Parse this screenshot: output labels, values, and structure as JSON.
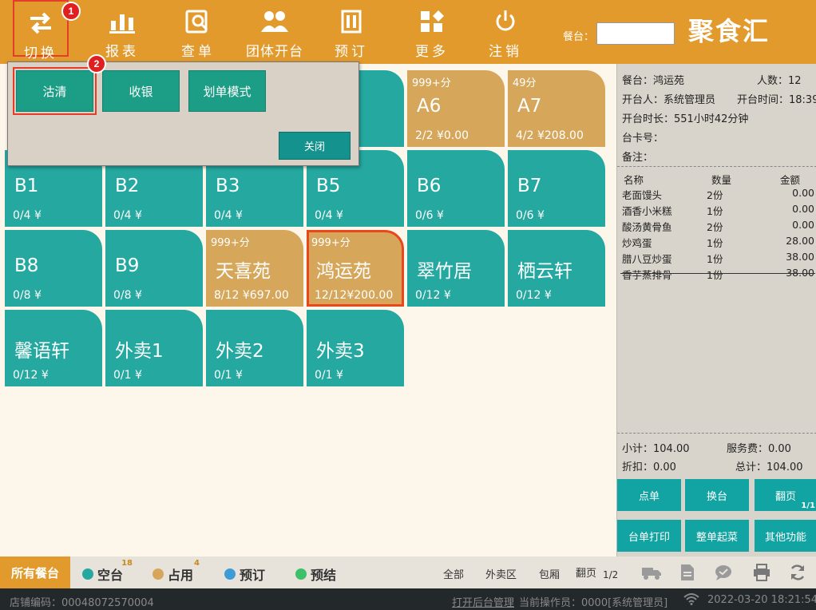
{
  "toolbar": {
    "items": [
      {
        "label": "切换",
        "icon": "switch-arrows-icon"
      },
      {
        "label": "报表",
        "icon": "bar-chart-icon"
      },
      {
        "label": "查单",
        "icon": "search-document-icon"
      },
      {
        "label": "团体开台",
        "icon": "group-users-icon"
      },
      {
        "label": "预订",
        "icon": "reservation-book-icon"
      },
      {
        "label": "更多",
        "icon": "more-shapes-icon"
      },
      {
        "label": "注销",
        "icon": "power-icon"
      }
    ],
    "table_search_label": "餐台：",
    "table_search_value": "",
    "brand": "聚食汇",
    "annotation_1": "1",
    "annotation_2": "2"
  },
  "popup": {
    "buttons": [
      "沽清",
      "收银",
      "划单模式"
    ],
    "close_label": "关闭"
  },
  "tables": [
    {
      "name": "",
      "tag": "",
      "stat": "",
      "status": "free"
    },
    {
      "name": "A6",
      "tag": "999+分",
      "stat": "2/2  ¥0.00",
      "status": "occupied"
    },
    {
      "name": "A7",
      "tag": "49分",
      "stat": "4/2  ¥208.00",
      "status": "occupied"
    },
    {
      "name": "B1",
      "tag": "",
      "stat": "0/4  ¥",
      "status": "free"
    },
    {
      "name": "B2",
      "tag": "",
      "stat": "0/4  ¥",
      "status": "free"
    },
    {
      "name": "B3",
      "tag": "",
      "stat": "0/4  ¥",
      "status": "free"
    },
    {
      "name": "B5",
      "tag": "",
      "stat": "0/4  ¥",
      "status": "free"
    },
    {
      "name": "B6",
      "tag": "",
      "stat": "0/6  ¥",
      "status": "free"
    },
    {
      "name": "B7",
      "tag": "",
      "stat": "0/6  ¥",
      "status": "free"
    },
    {
      "name": "B8",
      "tag": "",
      "stat": "0/8  ¥",
      "status": "free"
    },
    {
      "name": "B9",
      "tag": "",
      "stat": "0/8  ¥",
      "status": "free"
    },
    {
      "name": "天喜苑",
      "tag": "999+分",
      "stat": "8/12 ¥697.00",
      "status": "occupied"
    },
    {
      "name": "鸿运苑",
      "tag": "999+分",
      "stat": "12/12¥200.00",
      "status": "occupied"
    },
    {
      "name": "翠竹居",
      "tag": "",
      "stat": "0/12 ¥",
      "status": "free"
    },
    {
      "name": "栖云轩",
      "tag": "",
      "stat": "0/12 ¥",
      "status": "free"
    },
    {
      "name": "馨语轩",
      "tag": "",
      "stat": "0/12 ¥",
      "status": "free"
    },
    {
      "name": "外卖1",
      "tag": "",
      "stat": "0/1  ¥",
      "status": "free"
    },
    {
      "name": "外卖2",
      "tag": "",
      "stat": "0/1  ¥",
      "status": "free"
    },
    {
      "name": "外卖3",
      "tag": "",
      "stat": "0/1  ¥",
      "status": "free"
    }
  ],
  "order_info": {
    "table": "餐台：鸿运苑",
    "people": "人数：12",
    "opener": "开台人：系统管理员",
    "open_time": "开台时间：18:39",
    "duration": "开台时长：551小时42分钟",
    "card_no": "台卡号：",
    "remark": "备注：",
    "headers": [
      "名称",
      "数量",
      "金额"
    ],
    "items": [
      {
        "name": "老面馒头",
        "qty": "2份",
        "amount": "0.00"
      },
      {
        "name": "酒香小米糕",
        "qty": "1份",
        "amount": "0.00"
      },
      {
        "name": "酸汤黄骨鱼",
        "qty": "2份",
        "amount": "0.00"
      },
      {
        "name": "炒鸡蛋",
        "qty": "1份",
        "amount": "28.00"
      },
      {
        "name": "腊八豆炒蛋",
        "qty": "1份",
        "amount": "38.00"
      },
      {
        "name": "香芋蒸排骨",
        "qty": "1份",
        "amount": "38.00"
      }
    ],
    "subtotal": "小计：104.00",
    "service_fee": "服务费：0.00",
    "discount": "折扣：0.00",
    "total": "总计：104.00",
    "actions": [
      "点单",
      "换台",
      "翻页",
      "台单打印",
      "整单起菜",
      "其他功能"
    ],
    "page_indicator": "1/1"
  },
  "legend": {
    "all_label": "所有餐台",
    "items": [
      {
        "label": "空台",
        "count": "18",
        "color": "#24a8a0"
      },
      {
        "label": "占用",
        "count": "4",
        "color": "#d6a75a"
      },
      {
        "label": "预订",
        "count": "",
        "color": "#3d9bd6"
      },
      {
        "label": "预结",
        "count": "",
        "color": "#3cc06a"
      }
    ],
    "filters": [
      "全部",
      "外卖区",
      "包厢",
      "翻页"
    ],
    "page": "1/2"
  },
  "status_bar": {
    "store_code": "店铺编码：00048072570004",
    "backend_link": "打开后台管理",
    "operator": "当前操作员：0000[系统管理员]",
    "datetime": "2022-03-20 18:21:54"
  },
  "colors": {
    "brand_orange": "#e19a2b",
    "free_teal": "#24a8a0",
    "occupied_tan": "#d6a75a",
    "highlight_red": "#e43d2a"
  }
}
